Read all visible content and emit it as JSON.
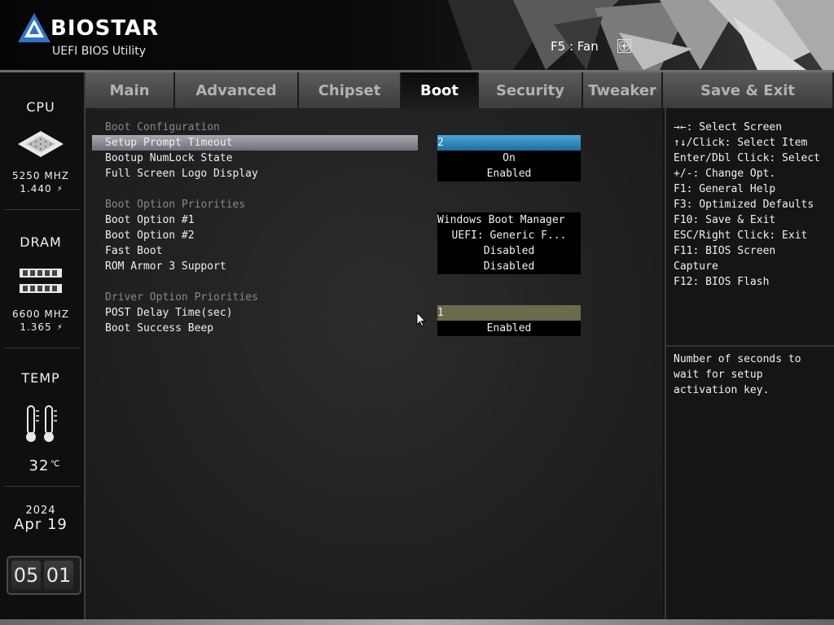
{
  "header": {
    "brand": "BIOSTAR",
    "subtitle": "UEFI BIOS Utility",
    "fan_label": "F5 : Fan",
    "fan_icon": "fan-icon"
  },
  "sidebar": {
    "cpu": {
      "label": "CPU",
      "freq": "5250 MHZ",
      "volt": "1.440"
    },
    "dram": {
      "label": "DRAM",
      "freq": "6600 MHZ",
      "volt": "1.365"
    },
    "temp": {
      "label": "TEMP",
      "value": "32"
    },
    "date": {
      "year": "2024",
      "month_day": "Apr 19"
    },
    "clock": {
      "hours": "05",
      "minutes": "01"
    }
  },
  "tabs": [
    {
      "label": "Main"
    },
    {
      "label": "Advanced"
    },
    {
      "label": "Chipset"
    },
    {
      "label": "Boot"
    },
    {
      "label": "Security"
    },
    {
      "label": "Tweaker"
    },
    {
      "label": "Save & Exit"
    }
  ],
  "active_tab": "Boot",
  "boot": {
    "group1": "Boot Configuration",
    "setup_prompt": {
      "label": "Setup Prompt Timeout",
      "value": "2"
    },
    "numlock": {
      "label": "Bootup NumLock State",
      "value": "On"
    },
    "logo": {
      "label": "Full Screen Logo Display",
      "value": "Enabled"
    },
    "group2": "Boot Option Priorities",
    "opt1": {
      "label": "Boot Option #1",
      "value": "Windows Boot Manager"
    },
    "opt2": {
      "label": "Boot Option #2",
      "value": "UEFI: Generic F..."
    },
    "fast": {
      "label": "Fast Boot",
      "value": "Disabled"
    },
    "rom": {
      "label": "ROM Armor 3 Support",
      "value": "Disabled"
    },
    "group3": "Driver Option Priorities",
    "post": {
      "label": "POST Delay Time(sec)",
      "value": "1"
    },
    "beep": {
      "label": "Boot Success Beep",
      "value": "Enabled"
    }
  },
  "help": {
    "lines": [
      "→←: Select Screen",
      "↑↓/Click: Select Item",
      "Enter/Dbl Click: Select",
      "+/-: Change Opt.",
      "F1: General Help",
      "F3: Optimized Defaults",
      "F10: Save & Exit",
      "ESC/Right Click: Exit",
      "F11: BIOS Screen",
      "Capture",
      "F12: BIOS Flash"
    ],
    "description": "Number of seconds to\nwait for setup\nactivation key."
  },
  "colors": {
    "selection": "#2f8fc6",
    "olive_field": "#6a6a4c",
    "tab_active": "#0f0f0f"
  }
}
